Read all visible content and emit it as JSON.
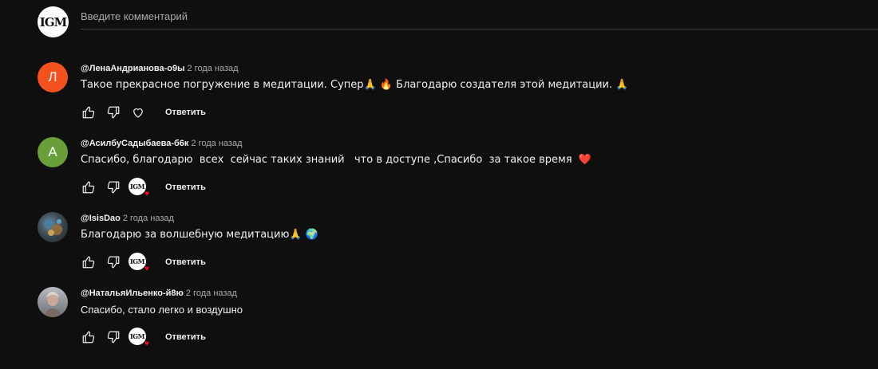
{
  "composer": {
    "logo_text": "IGM",
    "placeholder": "Введите комментарий"
  },
  "reply_label": "Ответить",
  "comments": [
    {
      "author": "@ЛенаАндрианова-о9ы",
      "time": "2 года назад",
      "text": "Такое прекрасное погружение в медитации. Супер🙏 🔥 Благодарю создателя этой медитации. 🙏",
      "avatar_letter": "Л",
      "avatar_color": "#f4511e",
      "liked_by_creator": false
    },
    {
      "author": "@АсилбуСадыбаева-б6к",
      "time": "2 года назад",
      "text": "Спасибо, благодарю  всех  сейчас таких знаний   что в доступе ,Спасибо  за такое время  ❤️",
      "avatar_letter": "А",
      "avatar_color": "#689f38",
      "liked_by_creator": true
    },
    {
      "author": "@IsisDao",
      "time": "2 года назад",
      "text": "Благодарю за волшебную медитацию🙏 🌍",
      "avatar_letter": "",
      "avatar_color": "#3b4a52",
      "liked_by_creator": true
    },
    {
      "author": "@НатальяИльенко-й8ю",
      "time": "2 года назад",
      "text": "Спасибо, стало легко и воздушно",
      "avatar_letter": "",
      "avatar_color": "#8a8e92",
      "liked_by_creator": true
    }
  ],
  "colors": {
    "background": "#0f0f0f",
    "text": "#f1f1f1",
    "secondary_text": "#aaaaaa",
    "heart": "#ff0033"
  }
}
